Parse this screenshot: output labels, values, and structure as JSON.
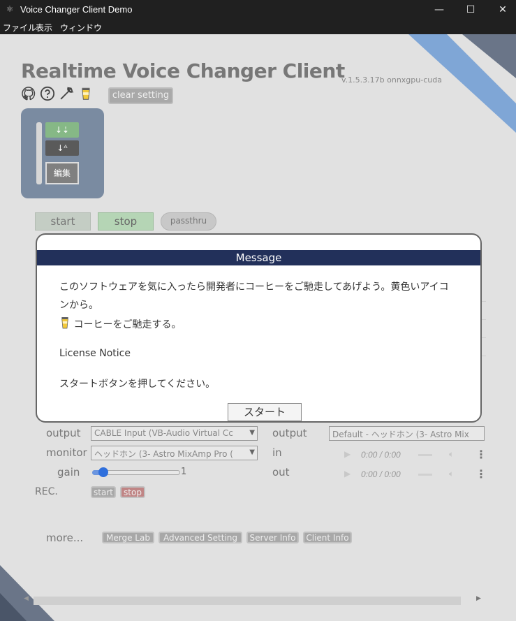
{
  "window": {
    "title": "Voice Changer Client Demo",
    "minimize": "—",
    "maximize": "☐",
    "close": "✕"
  },
  "menu": [
    "ファイル",
    "表示",
    "ウィンドウ"
  ],
  "header": {
    "title": "Realtime Voice Changer Client",
    "version": "v.1.5.3.17b  onnxgpu-cuda",
    "clear_setting": "clear setting",
    "icons": [
      "github-icon",
      "help-icon",
      "wrench-icon",
      "coffee-icon"
    ]
  },
  "model_panel": {
    "sort_asc": "↓⇣",
    "sort_desc": "↓ᴬ",
    "edit": "編集"
  },
  "controls": {
    "start": "start",
    "stop": "stop",
    "passthru": "passthru"
  },
  "modal": {
    "title": "Message",
    "text": "このソフトウェアを気に入ったら開発者にコーヒーをご馳走してあげよう。黄色いアイコンから。",
    "coffee": "コーヒーをご馳走する。",
    "license": "License Notice",
    "instruction": "スタートボタンを押してください。",
    "start_button": "スタート"
  },
  "audio": {
    "output_label": "output",
    "output_value": "CABLE Input (VB-Audio Virtual Cc",
    "monitor_label": "monitor",
    "monitor_value": "ヘッドホン (3- Astro MixAmp Pro (",
    "gain_label": "gain",
    "gain_value": "1",
    "gain_fraction": 0.1,
    "right_output_label": "output",
    "right_output_value": "Default - ヘッドホン (3- Astro Mix",
    "in_label": "in",
    "out_label": "out",
    "time": "0:00 / 0:00"
  },
  "rec": {
    "label": "REC.",
    "start": "start",
    "stop": "stop"
  },
  "more": {
    "label": "more...",
    "buttons": [
      "Merge Lab",
      "Advanced Setting",
      "Server Info",
      "Client Info"
    ]
  },
  "colors": {
    "accent_blue": "#7fa6d6",
    "header_navy": "#22305a",
    "panel": "#7a8ba1"
  }
}
